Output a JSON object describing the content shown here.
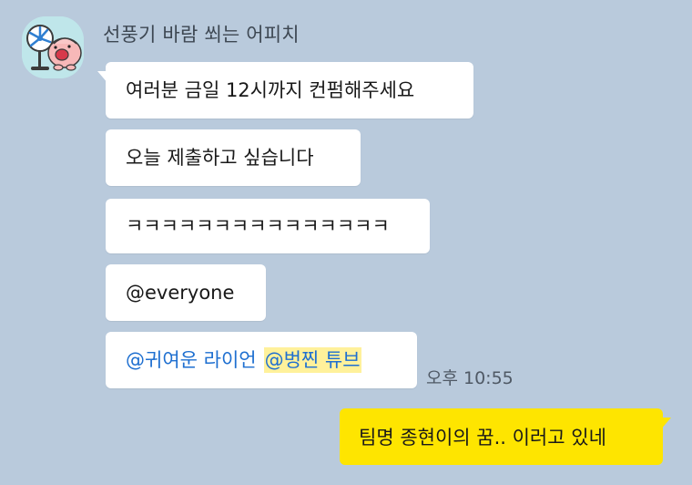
{
  "sender": {
    "name": "선풍기 바람 쐬는 어피치",
    "avatar_icon": "apeach-fan-avatar-icon"
  },
  "messages": [
    {
      "text": "여러분 금일 12시까지 컨펌해주세요"
    },
    {
      "text": "오늘 제출하고 싶습니다"
    },
    {
      "text": "ㅋㅋㅋㅋㅋㅋㅋㅋㅋㅋㅋㅋㅋㅋㅋ"
    },
    {
      "text": "@everyone"
    },
    {
      "mention_1": "@귀여운 라이언",
      "mention_2": "@벙찐 튜브"
    }
  ],
  "timestamp": "오후 10:55",
  "my_message": {
    "text": "팀명 종현이의 꿈.. 이러고 있네"
  },
  "colors": {
    "background": "#b9cadc",
    "incoming_bubble": "#ffffff",
    "outgoing_bubble": "#fee500",
    "mention": "#1e6fd0",
    "mention_highlight": "#fff19b"
  }
}
